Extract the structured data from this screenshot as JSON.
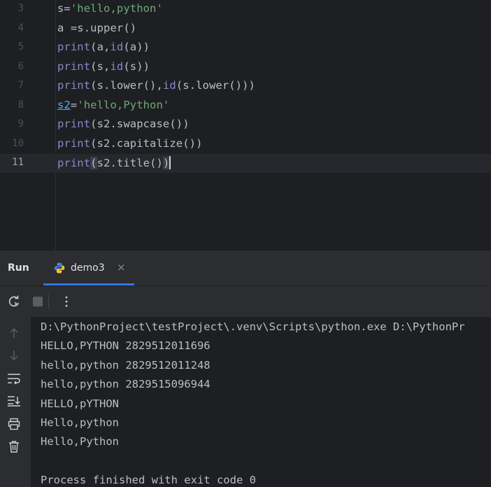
{
  "editor": {
    "current_line": "11",
    "lines": [
      {
        "num": "3",
        "parts": [
          [
            "s=",
            ""
          ],
          [
            "'hello,python'",
            "str"
          ]
        ]
      },
      {
        "num": "4",
        "parts": [
          [
            "a =s.upper()",
            ""
          ]
        ]
      },
      {
        "num": "5",
        "parts": [
          [
            "print",
            "fn"
          ],
          [
            "(a,",
            ""
          ],
          [
            "id",
            "fn"
          ],
          [
            "(a))",
            ""
          ]
        ]
      },
      {
        "num": "6",
        "parts": [
          [
            "print",
            "fn"
          ],
          [
            "(s,",
            ""
          ],
          [
            "id",
            "fn"
          ],
          [
            "(s))",
            ""
          ]
        ]
      },
      {
        "num": "7",
        "parts": [
          [
            "print",
            "fn"
          ],
          [
            "(s.lower(),",
            ""
          ],
          [
            "id",
            "fn"
          ],
          [
            "(s.lower()))",
            ""
          ]
        ]
      },
      {
        "num": "8",
        "parts": [
          [
            "s2",
            "varul"
          ],
          [
            "=",
            ""
          ],
          [
            "'hello,Python'",
            "str"
          ]
        ]
      },
      {
        "num": "9",
        "parts": [
          [
            "print",
            "fn"
          ],
          [
            "(s2.swapcase())",
            ""
          ]
        ]
      },
      {
        "num": "10",
        "parts": [
          [
            "print",
            "fn"
          ],
          [
            "(s2.capitalize())",
            ""
          ]
        ]
      },
      {
        "num": "11",
        "parts": [
          [
            "print",
            "fn"
          ],
          [
            "(",
            "hl"
          ],
          [
            "s2.title()",
            ""
          ],
          [
            ")",
            "hl"
          ]
        ]
      }
    ]
  },
  "run_panel": {
    "title": "Run",
    "tab_label": "demo3",
    "tab_close": "×",
    "accent": "#3574f0"
  },
  "toolbar": {
    "icons": [
      "rerun-icon",
      "stop-icon",
      "more-vertical-icon"
    ]
  },
  "side_tools": {
    "icons": [
      "arrow-up-icon",
      "arrow-down-icon",
      "soft-wrap-icon",
      "scroll-to-end-icon",
      "print-icon",
      "trash-icon"
    ]
  },
  "console": {
    "lines": [
      "D:\\PythonProject\\testProject\\.venv\\Scripts\\python.exe D:\\PythonPr",
      "HELLO,PYTHON 2829512011696",
      "hello,python 2829512011248",
      "hello,python 2829515096944",
      "HELLO,pYTHON",
      "Hello,python",
      "Hello,Python",
      "",
      "Process finished with exit code 0"
    ]
  }
}
